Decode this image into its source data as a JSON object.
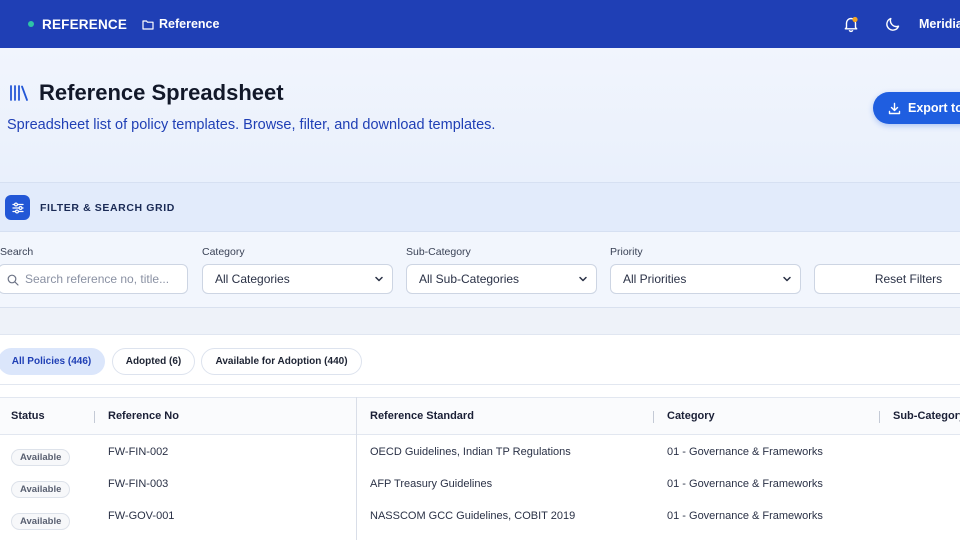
{
  "topbar": {
    "brand": "REFERENCE",
    "breadcrumb": "Reference",
    "user": "Meridia"
  },
  "header": {
    "title": "Reference Spreadsheet",
    "subtitle": "Spreadsheet list of policy templates. Browse, filter, and download templates.",
    "export_label": "Export to"
  },
  "filters": {
    "panel_title": "FILTER & SEARCH GRID",
    "search": {
      "label": "Search",
      "placeholder": "Search reference no, title..."
    },
    "category": {
      "label": "Category",
      "value": "All Categories"
    },
    "subcategory": {
      "label": "Sub-Category",
      "value": "All Sub-Categories"
    },
    "priority": {
      "label": "Priority",
      "value": "All Priorities"
    },
    "reset_label": "Reset Filters"
  },
  "tabs": [
    {
      "label": "All Policies (446)",
      "active": true
    },
    {
      "label": "Adopted (6)",
      "active": false
    },
    {
      "label": "Available for Adoption (440)",
      "active": false
    }
  ],
  "table": {
    "columns": [
      "Status",
      "Reference No",
      "Reference Standard",
      "Category",
      "Sub-Category"
    ],
    "rows": [
      {
        "status": "Available",
        "ref_no": "FW-FIN-002",
        "standard": "OECD Guidelines, Indian TP Regulations",
        "category": "01 - Governance & Frameworks"
      },
      {
        "status": "Available",
        "ref_no": "FW-FIN-003",
        "standard": "AFP Treasury Guidelines",
        "category": "01 - Governance & Frameworks"
      },
      {
        "status": "Available",
        "ref_no": "FW-GOV-001",
        "standard": "NASSCOM GCC Guidelines, COBIT 2019",
        "category": "01 - Governance & Frameworks"
      }
    ]
  },
  "colors": {
    "topbar": "#1f3fb5",
    "accent": "#1f5ee0",
    "brand_dot": "#2ec4a6",
    "notification_dot": "#f5a623"
  },
  "icons": [
    "library-icon",
    "folder-icon",
    "bell-icon",
    "moon-icon",
    "export-icon",
    "sliders-icon",
    "search-icon",
    "chevron-down-icon"
  ]
}
